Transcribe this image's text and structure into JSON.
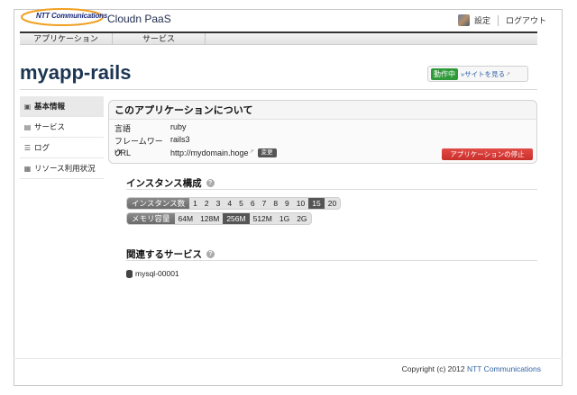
{
  "header": {
    "logo_text": "NTT Communications",
    "product": "Cloudn PaaS",
    "settings_label": "設定",
    "logout_label": "ログアウト"
  },
  "nav": {
    "items": [
      "アプリケーション",
      "サービス"
    ]
  },
  "app": {
    "title": "myapp-rails",
    "status_badge": "動作中",
    "site_link": "»サイトを見る"
  },
  "sidebar": {
    "items": [
      {
        "label": "基本情報",
        "icon": "cube-icon",
        "active": true
      },
      {
        "label": "サービス",
        "icon": "database-icon",
        "active": false
      },
      {
        "label": "ログ",
        "icon": "list-icon",
        "active": false
      },
      {
        "label": "リソース利用状況",
        "icon": "chart-icon",
        "active": false
      }
    ]
  },
  "about": {
    "title": "このアプリケーションについて",
    "language_key": "言語",
    "language_val": "ruby",
    "framework_key": "フレームワーク",
    "framework_val": "rails3",
    "url_key": "URL",
    "url_val": "http://mydomain.hoge",
    "change_label": "変更",
    "stop_label": "アプリケーションの停止"
  },
  "instances": {
    "title": "インスタンス構成",
    "count_label": "インスタンス数",
    "counts": [
      "1",
      "2",
      "3",
      "4",
      "5",
      "6",
      "7",
      "8",
      "9",
      "10",
      "15",
      "20"
    ],
    "count_selected": "15",
    "memory_label": "メモリ容量",
    "memories": [
      "64M",
      "128M",
      "256M",
      "512M",
      "1G",
      "2G"
    ],
    "memory_selected": "256M"
  },
  "services": {
    "title": "関連するサービス",
    "items": [
      "mysql-00001"
    ]
  },
  "footer": {
    "copyright": "Copyright (c) 2012",
    "company": "NTT Communications"
  },
  "colors": {
    "accent_blue": "#3465a4",
    "title_navy": "#1c3553",
    "status_green": "#2f9a3a",
    "stop_red": "#c9302c"
  }
}
